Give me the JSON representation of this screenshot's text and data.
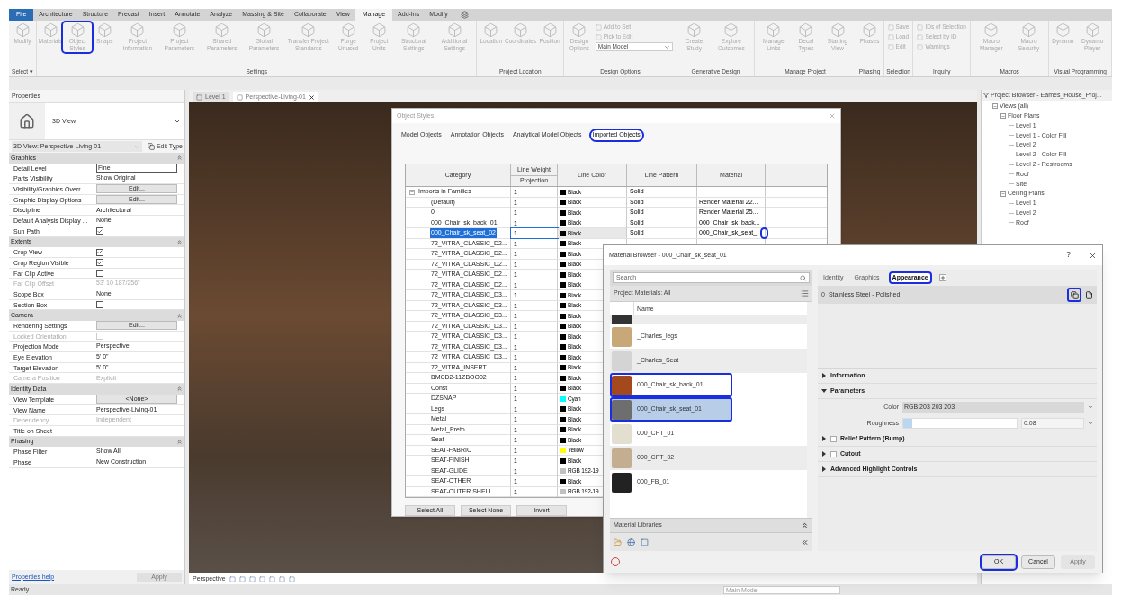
{
  "ribbon": {
    "tabs": [
      {
        "label": "File",
        "kind": "file",
        "selected": false
      },
      {
        "label": "Architecture",
        "kind": "tab",
        "selected": false
      },
      {
        "label": "Structure",
        "kind": "tab",
        "selected": false
      },
      {
        "label": "Precast",
        "kind": "tab",
        "selected": false
      },
      {
        "label": "Insert",
        "kind": "tab",
        "selected": false
      },
      {
        "label": "Annotate",
        "kind": "tab",
        "selected": false
      },
      {
        "label": "Analyze",
        "kind": "tab",
        "selected": false
      },
      {
        "label": "Massing & Site",
        "kind": "tab",
        "selected": false
      },
      {
        "label": "Collaborate",
        "kind": "tab",
        "selected": false
      },
      {
        "label": "View",
        "kind": "tab",
        "selected": false
      },
      {
        "label": "Manage",
        "kind": "tab",
        "selected": true
      },
      {
        "label": "Add-Ins",
        "kind": "tab",
        "selected": false
      },
      {
        "label": "Modify",
        "kind": "tab",
        "selected": false
      }
    ],
    "groups": [
      {
        "label": "Select ▾",
        "tools": [
          {
            "kind": "large",
            "label": "Modify",
            "highlighted": false
          }
        ]
      },
      {
        "label": "Settings",
        "tools": [
          {
            "kind": "large",
            "label": "Materials",
            "highlighted": false
          },
          {
            "kind": "large",
            "label": "Object Styles",
            "highlighted": true
          },
          {
            "kind": "large",
            "label": "Snaps",
            "highlighted": false
          },
          {
            "kind": "large",
            "label": "Project Information",
            "highlighted": false
          },
          {
            "kind": "large",
            "label": "Project Parameters",
            "highlighted": false
          },
          {
            "kind": "large",
            "label": "Shared Parameters",
            "highlighted": false
          },
          {
            "kind": "large",
            "label": "Global Parameters",
            "highlighted": false
          },
          {
            "kind": "large",
            "label": "Transfer Project Standards",
            "highlighted": false
          },
          {
            "kind": "large",
            "label": "Purge Unused",
            "highlighted": false
          },
          {
            "kind": "large",
            "label": "Project Units",
            "highlighted": false
          },
          {
            "kind": "large",
            "label": "Structural Settings",
            "highlighted": false
          },
          {
            "kind": "large",
            "label": "Additional Settings",
            "highlighted": false
          }
        ]
      },
      {
        "label": "Project Location",
        "tools": [
          {
            "kind": "large",
            "label": "Location",
            "highlighted": false
          },
          {
            "kind": "large",
            "label": "Coordinates",
            "highlighted": false
          },
          {
            "kind": "large",
            "label": "Position",
            "highlighted": false
          }
        ]
      },
      {
        "label": "Design Options",
        "tools": [
          {
            "kind": "large",
            "label": "Design Options",
            "highlighted": false
          },
          {
            "kind": "stack",
            "items": [
              {
                "kind": "small",
                "label": "Add to Set"
              },
              {
                "kind": "small",
                "label": "Pick to Edit"
              },
              {
                "kind": "dropdown",
                "label": "Main Model"
              }
            ]
          }
        ]
      },
      {
        "label": "Generative Design",
        "tools": [
          {
            "kind": "large",
            "label": "Create Study",
            "highlighted": false
          },
          {
            "kind": "large",
            "label": "Explore Outcomes",
            "highlighted": false
          }
        ]
      },
      {
        "label": "Manage Project",
        "tools": [
          {
            "kind": "large",
            "label": "Manage Links",
            "highlighted": false
          },
          {
            "kind": "large",
            "label": "Decal Types",
            "highlighted": false
          },
          {
            "kind": "large",
            "label": "Starting View",
            "highlighted": false
          }
        ]
      },
      {
        "label": "Phasing",
        "tools": [
          {
            "kind": "large",
            "label": "Phases",
            "highlighted": false
          }
        ]
      },
      {
        "label": "Selection",
        "tools": [
          {
            "kind": "stack",
            "items": [
              {
                "kind": "small",
                "label": "Save"
              },
              {
                "kind": "small",
                "label": "Load"
              },
              {
                "kind": "small",
                "label": "Edit"
              }
            ]
          }
        ]
      },
      {
        "label": "Inquiry",
        "tools": [
          {
            "kind": "stack",
            "items": [
              {
                "kind": "small",
                "label": "IDs of Selection"
              },
              {
                "kind": "small",
                "label": "Select by ID"
              },
              {
                "kind": "small",
                "label": "Warnings"
              }
            ]
          }
        ]
      },
      {
        "label": "Macros",
        "tools": [
          {
            "kind": "large",
            "label": "Macro Manager",
            "highlighted": false
          },
          {
            "kind": "large",
            "label": "Macro Security",
            "highlighted": false
          }
        ]
      },
      {
        "label": "Visual Programming",
        "tools": [
          {
            "kind": "large",
            "label": "Dynamo",
            "highlighted": false
          },
          {
            "kind": "large",
            "label": "Dynamo Player",
            "highlighted": false
          }
        ]
      }
    ]
  },
  "properties": {
    "title": "Properties",
    "type_name": "3D View",
    "instance": "3D View: Perspective-Living-01",
    "edit_type": "Edit Type",
    "sections": [
      {
        "label": "Graphics",
        "rows": [
          {
            "name": "Detail Level",
            "kind": "field",
            "value": "Fine",
            "disabled": false
          },
          {
            "name": "Parts Visibility",
            "kind": "text",
            "value": "Show Original",
            "disabled": false
          },
          {
            "name": "Visibility/Graphics Overr...",
            "kind": "button",
            "value": "Edit...",
            "disabled": false
          },
          {
            "name": "Graphic Display Options",
            "kind": "button",
            "value": "Edit...",
            "disabled": false
          },
          {
            "name": "Discipline",
            "kind": "text",
            "value": "Architectural",
            "disabled": false
          },
          {
            "name": "Default Analysis Display ...",
            "kind": "text",
            "value": "None",
            "disabled": false
          },
          {
            "name": "Sun Path",
            "kind": "checkbox",
            "checked": true,
            "disabled": false
          }
        ]
      },
      {
        "label": "Extents",
        "rows": [
          {
            "name": "Crop View",
            "kind": "checkbox",
            "checked": true,
            "disabled": false
          },
          {
            "name": "Crop Region Visible",
            "kind": "checkbox",
            "checked": true,
            "disabled": false
          },
          {
            "name": "Far Clip Active",
            "kind": "checkbox",
            "checked": false,
            "disabled": false
          },
          {
            "name": "Far Clip Offset",
            "kind": "text",
            "value": "53'  10 187/256\"",
            "disabled": true
          },
          {
            "name": "Scope Box",
            "kind": "text",
            "value": "None",
            "disabled": false
          },
          {
            "name": "Section Box",
            "kind": "checkbox",
            "checked": false,
            "disabled": false
          }
        ]
      },
      {
        "label": "Camera",
        "rows": [
          {
            "name": "Rendering Settings",
            "kind": "button",
            "value": "Edit...",
            "disabled": false
          },
          {
            "name": "Locked Orientation",
            "kind": "checkbox",
            "checked": false,
            "disabled": true
          },
          {
            "name": "Projection Mode",
            "kind": "text",
            "value": "Perspective",
            "disabled": false
          },
          {
            "name": "Eye Elevation",
            "kind": "text",
            "value": "5'  0\"",
            "disabled": false
          },
          {
            "name": "Target Elevation",
            "kind": "text",
            "value": "5'  0\"",
            "disabled": false
          },
          {
            "name": "Camera Position",
            "kind": "text",
            "value": "Explicit",
            "disabled": true
          }
        ]
      },
      {
        "label": "Identity Data",
        "rows": [
          {
            "name": "View Template",
            "kind": "button",
            "value": "<None>",
            "disabled": false
          },
          {
            "name": "View Name",
            "kind": "text",
            "value": "Perspective-Living-01",
            "disabled": false
          },
          {
            "name": "Dependency",
            "kind": "text",
            "value": "Independent",
            "disabled": true
          },
          {
            "name": "Title on Sheet",
            "kind": "text",
            "disabled": false
          }
        ]
      },
      {
        "label": "Phasing",
        "rows": [
          {
            "name": "Phase Filter",
            "kind": "text",
            "value": "Show All",
            "disabled": false
          },
          {
            "name": "Phase",
            "kind": "text",
            "value": "New Construction",
            "disabled": false
          }
        ]
      }
    ],
    "help_link": "Properties help",
    "apply": "Apply"
  },
  "view_tabs": [
    {
      "label": "Level 1",
      "selected": false
    },
    {
      "label": "Perspective-Living-01",
      "selected": true
    }
  ],
  "view_bar": {
    "label": "Perspective"
  },
  "project_browser": {
    "title": "Project Browser - Eames_House_Proj...",
    "tree": [
      {
        "label": "Views (all)",
        "expanded": true,
        "children": [
          {
            "label": "Floor Plans",
            "expanded": true,
            "children": [
              {
                "label": "Level 1"
              },
              {
                "label": "Level 1 - Color Fill"
              },
              {
                "label": "Level 2"
              },
              {
                "label": "Level 2 - Color Fill"
              },
              {
                "label": "Level 2 - Restrooms"
              },
              {
                "label": "Roof"
              },
              {
                "label": "Site"
              }
            ]
          },
          {
            "label": "Ceiling Plans",
            "expanded": true,
            "children": [
              {
                "label": "Level 1"
              },
              {
                "label": "Level 2"
              },
              {
                "label": "Roof"
              }
            ]
          }
        ]
      }
    ]
  },
  "object_styles": {
    "title": "Object Styles",
    "tabs": [
      {
        "label": "Model Objects",
        "selected": false,
        "highlighted": false
      },
      {
        "label": "Annotation Objects",
        "selected": false,
        "highlighted": false
      },
      {
        "label": "Analytical Model Objects",
        "selected": false,
        "highlighted": false
      },
      {
        "label": "Imported Objects",
        "selected": true,
        "highlighted": true
      }
    ],
    "columns": {
      "category": "Category",
      "line_weight": "Line Weight",
      "projection": "Projection",
      "line_color": "Line Color",
      "line_pattern": "Line Pattern",
      "material": "Material"
    },
    "rows": [
      {
        "category": "Imports in Families",
        "expanded": true,
        "weight": "1",
        "line_color": "Black",
        "color": "#000000",
        "line_pattern": "Solid",
        "selected": false,
        "children": [
          {
            "category": "(Default)",
            "weight": "1",
            "line_color": "Black",
            "color": "#000000",
            "line_pattern": "Solid",
            "material": "Render Material 22...",
            "selected": false
          },
          {
            "category": "0",
            "weight": "1",
            "line_color": "Black",
            "color": "#000000",
            "line_pattern": "Solid",
            "material": "Render Material 25...",
            "selected": false
          },
          {
            "category": "000_Chair_sk_back_01",
            "weight": "1",
            "line_color": "Black",
            "color": "#000000",
            "line_pattern": "Solid",
            "material": "000_Chair_sk_back...",
            "selected": false
          },
          {
            "category": "000_Chair_sk_seat_02",
            "weight": "1",
            "line_color": "Black",
            "color": "#000000",
            "line_pattern": "Solid",
            "material": "000_Chair_sk_seat_",
            "selected": true,
            "browse_highlighted": true
          },
          {
            "category": "72_VITRA_CLASSIC_D2...",
            "weight": "1",
            "line_color": "Black",
            "color": "#000000",
            "selected": false
          },
          {
            "category": "72_VITRA_CLASSIC_D2...",
            "weight": "1",
            "line_color": "Black",
            "color": "#000000",
            "selected": false
          },
          {
            "category": "72_VITRA_CLASSIC_D2...",
            "weight": "1",
            "line_color": "Black",
            "color": "#000000",
            "selected": false
          },
          {
            "category": "72_VITRA_CLASSIC_D2...",
            "weight": "1",
            "line_color": "Black",
            "color": "#000000",
            "selected": false
          },
          {
            "category": "72_VITRA_CLASSIC_D2...",
            "weight": "1",
            "line_color": "Black",
            "color": "#000000",
            "selected": false
          },
          {
            "category": "72_VITRA_CLASSIC_D3...",
            "weight": "1",
            "line_color": "Black",
            "color": "#000000",
            "selected": false
          },
          {
            "category": "72_VITRA_CLASSIC_D3...",
            "weight": "1",
            "line_color": "Black",
            "color": "#000000",
            "selected": false
          },
          {
            "category": "72_VITRA_CLASSIC_D3...",
            "weight": "1",
            "line_color": "Black",
            "color": "#000000",
            "selected": false
          },
          {
            "category": "72_VITRA_CLASSIC_D3...",
            "weight": "1",
            "line_color": "Black",
            "color": "#000000",
            "selected": false
          },
          {
            "category": "72_VITRA_CLASSIC_D3...",
            "weight": "1",
            "line_color": "Black",
            "color": "#000000",
            "selected": false
          },
          {
            "category": "72_VITRA_CLASSIC_D3...",
            "weight": "1",
            "line_color": "Black",
            "color": "#000000",
            "selected": false
          },
          {
            "category": "72_VITRA_CLASSIC_D3...",
            "weight": "1",
            "line_color": "Black",
            "color": "#000000",
            "selected": false
          },
          {
            "category": "72_VITRA_INSERT",
            "weight": "1",
            "line_color": "Black",
            "color": "#000000",
            "selected": false
          },
          {
            "category": "BMCD2-11ZBOO02",
            "weight": "1",
            "line_color": "Black",
            "color": "#000000",
            "selected": false
          },
          {
            "category": "Const",
            "weight": "1",
            "line_color": "Black",
            "color": "#000000",
            "selected": false
          },
          {
            "category": "DZSNAP",
            "weight": "1",
            "line_color": "Cyan",
            "color": "#00ffff",
            "selected": false
          },
          {
            "category": "Legs",
            "weight": "1",
            "line_color": "Black",
            "color": "#000000",
            "selected": false
          },
          {
            "category": "Metal",
            "weight": "1",
            "line_color": "Black",
            "color": "#000000",
            "selected": false
          },
          {
            "category": "Metal_Preto",
            "weight": "1",
            "line_color": "Black",
            "color": "#000000",
            "selected": false
          },
          {
            "category": "Seat",
            "weight": "1",
            "line_color": "Black",
            "color": "#000000",
            "selected": false
          },
          {
            "category": "SEAT-FABRIC",
            "weight": "1",
            "line_color": "Yellow",
            "color": "#ffff00",
            "selected": false
          },
          {
            "category": "SEAT-FINISH",
            "weight": "1",
            "line_color": "Black",
            "color": "#000000",
            "selected": false
          },
          {
            "category": "SEAT-GLIDE",
            "weight": "1",
            "line_color": "RGB 192-19",
            "color": "#c0c0c0",
            "selected": false
          },
          {
            "category": "SEAT-OTHER",
            "weight": "1",
            "line_color": "Black",
            "color": "#000000",
            "selected": false
          },
          {
            "category": "SEAT-OUTER SHELL",
            "weight": "1",
            "line_color": "RGB 192-19",
            "color": "#c0c0c0",
            "selected": false
          }
        ]
      }
    ],
    "buttons": [
      "Select All",
      "Select None",
      "Invert"
    ]
  },
  "material_browser": {
    "title": "Material Browser - 000_Chair_sk_seat_01",
    "help": "?",
    "search": {
      "placeholder": "Search"
    },
    "filter": "Project Materials: All",
    "name_header": "Name",
    "materials": [
      {
        "name": "_Charles_legs",
        "color": "#c8a878",
        "selected": false,
        "highlighted": false
      },
      {
        "name": "_Charles_Seat",
        "color": "#d4d4d4",
        "selected": false,
        "highlighted": false
      },
      {
        "name": "000_Chair_sk_back_01",
        "color": "#a4481e",
        "selected": false,
        "highlighted": true
      },
      {
        "name": "000_Chair_sk_seat_01",
        "color": "#6e6e6e",
        "selected": true,
        "highlighted": true
      },
      {
        "name": "000_CPT_01",
        "color": "#e2ded0",
        "selected": false,
        "highlighted": false
      },
      {
        "name": "000_CPT_02",
        "color": "#c4ae92",
        "selected": false,
        "highlighted": false
      },
      {
        "name": "000_FB_01",
        "color": "#222222",
        "selected": false,
        "highlighted": false
      }
    ],
    "libraries": "Material Libraries",
    "tabs": [
      {
        "label": "Identity",
        "selected": false,
        "highlighted": false
      },
      {
        "label": "Graphics",
        "selected": false,
        "highlighted": false
      },
      {
        "label": "Appearance",
        "selected": true,
        "highlighted": true
      }
    ],
    "asset": {
      "count": "0",
      "name": "Stainless Steel - Polished",
      "duplicate_highlighted": true
    },
    "sections": [
      {
        "label": "Information",
        "kind": "header",
        "expanded": false
      },
      {
        "label": "Parameters",
        "kind": "header",
        "expanded": true
      },
      {
        "label": "Color",
        "kind": "color",
        "value": "RGB 203 203 203"
      },
      {
        "label": "Roughness",
        "kind": "slider",
        "level": 0.08,
        "value": "0.08"
      },
      {
        "label": "Relief Pattern (Bump)",
        "kind": "check_header",
        "expanded": false,
        "checked": false
      },
      {
        "label": "Cutout",
        "kind": "check_header",
        "expanded": false,
        "checked": false
      },
      {
        "label": "Advanced Highlight Controls",
        "kind": "header",
        "expanded": false
      }
    ],
    "buttons": [
      {
        "label": "OK",
        "disabled": false,
        "highlighted": true
      },
      {
        "label": "Cancel",
        "disabled": false,
        "highlighted": false
      },
      {
        "label": "Apply",
        "disabled": true,
        "highlighted": false
      }
    ]
  },
  "status_bar": {
    "text": "Ready",
    "model": "Main Model"
  }
}
